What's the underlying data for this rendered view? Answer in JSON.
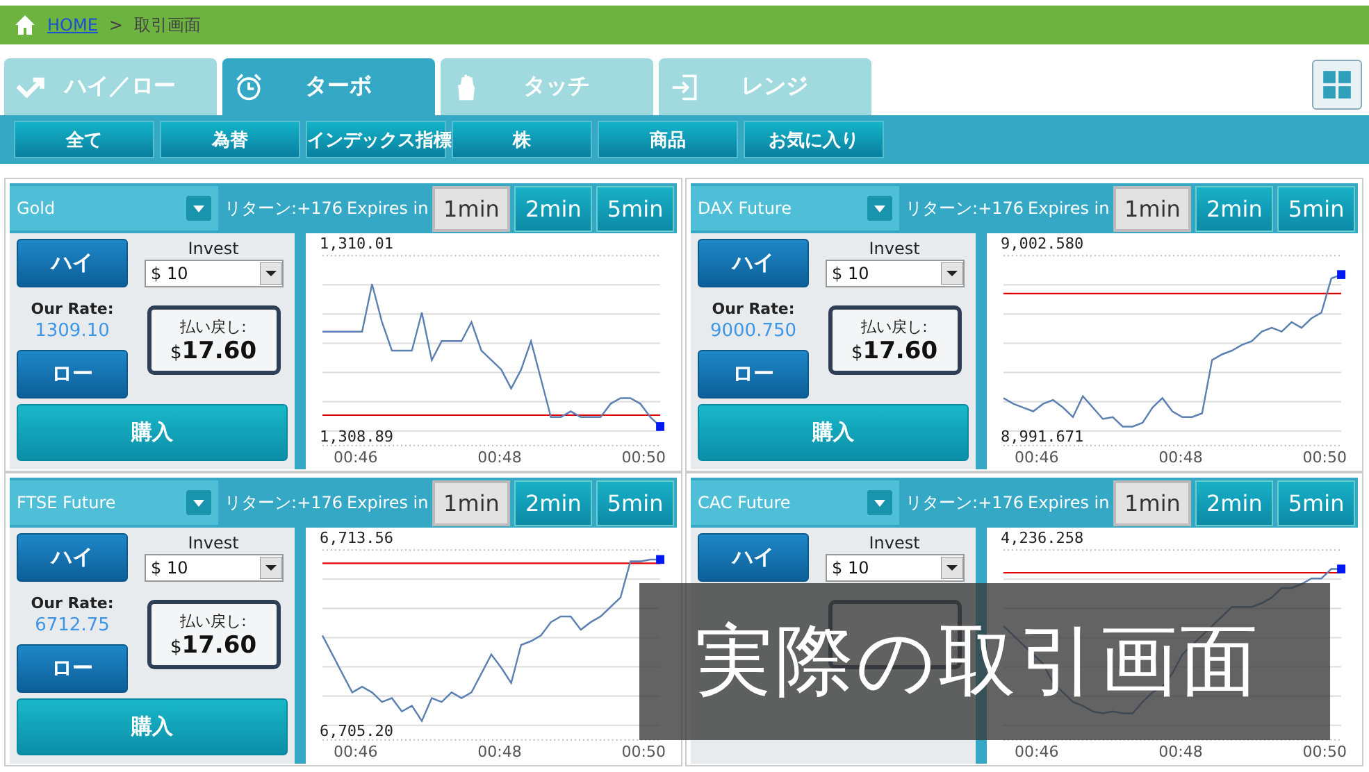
{
  "breadcrumb": {
    "home": "HOME",
    "separator": ">",
    "current": "取引画面"
  },
  "tabs": [
    {
      "label": "ハイ／ロー",
      "selected": false
    },
    {
      "label": "ターボ",
      "selected": true
    },
    {
      "label": "タッチ",
      "selected": false
    },
    {
      "label": "レンジ",
      "selected": false
    }
  ],
  "categories": [
    "全て",
    "為替",
    "インデックス指標",
    "株",
    "商品",
    "お気に入り"
  ],
  "panels": [
    {
      "asset": "Gold",
      "return_label": "リターン:+176",
      "expires_label": "Expires in",
      "durations": [
        {
          "label": "1min",
          "selected": true
        },
        {
          "label": "2min",
          "selected": false
        },
        {
          "label": "5min",
          "selected": false
        }
      ],
      "high_button": "ハイ",
      "low_button": "ロー",
      "invest_label": "Invest",
      "invest_value": "$ 10",
      "rate_label": "Our Rate:",
      "rate": "1309.10",
      "payout_label": "払い戻し:",
      "payout_currency": "$",
      "payout": "17.60",
      "buy_button": "購入",
      "y_max": "1,310.01",
      "y_min": "1,308.89",
      "x_labels": [
        "00:46",
        "00:48",
        "00:50"
      ]
    },
    {
      "asset": "DAX Future",
      "return_label": "リターン:+176",
      "expires_label": "Expires in",
      "durations": [
        {
          "label": "1min",
          "selected": true
        },
        {
          "label": "2min",
          "selected": false
        },
        {
          "label": "5min",
          "selected": false
        }
      ],
      "high_button": "ハイ",
      "low_button": "ロー",
      "invest_label": "Invest",
      "invest_value": "$ 10",
      "rate_label": "Our Rate:",
      "rate": "9000.750",
      "payout_label": "払い戻し:",
      "payout_currency": "$",
      "payout": "17.60",
      "buy_button": "購入",
      "y_max": "9,002.580",
      "y_min": "8,991.671",
      "x_labels": [
        "00:46",
        "00:48",
        "00:50"
      ]
    },
    {
      "asset": "FTSE Future",
      "return_label": "リターン:+176",
      "expires_label": "Expires in",
      "durations": [
        {
          "label": "1min",
          "selected": true
        },
        {
          "label": "2min",
          "selected": false
        },
        {
          "label": "5min",
          "selected": false
        }
      ],
      "high_button": "ハイ",
      "low_button": "ロー",
      "invest_label": "Invest",
      "invest_value": "$ 10",
      "rate_label": "Our Rate:",
      "rate": "6712.75",
      "payout_label": "払い戻し:",
      "payout_currency": "$",
      "payout": "17.60",
      "buy_button": "購入",
      "y_max": "6,713.56",
      "y_min": "6,705.20",
      "x_labels": [
        "00:46",
        "00:48",
        "00:50"
      ]
    },
    {
      "asset": "CAC Future",
      "return_label": "リターン:+176",
      "expires_label": "Expires in",
      "durations": [
        {
          "label": "1min",
          "selected": true
        },
        {
          "label": "2min",
          "selected": false
        },
        {
          "label": "5min",
          "selected": false
        }
      ],
      "high_button": "ハイ",
      "invest_label": "Invest",
      "invest_value": "$ 10",
      "y_max": "4,236.258",
      "x_labels": [
        "00:46",
        "00:48",
        "00:50"
      ]
    }
  ],
  "overlay": {
    "text": "実際の取引画面"
  }
}
